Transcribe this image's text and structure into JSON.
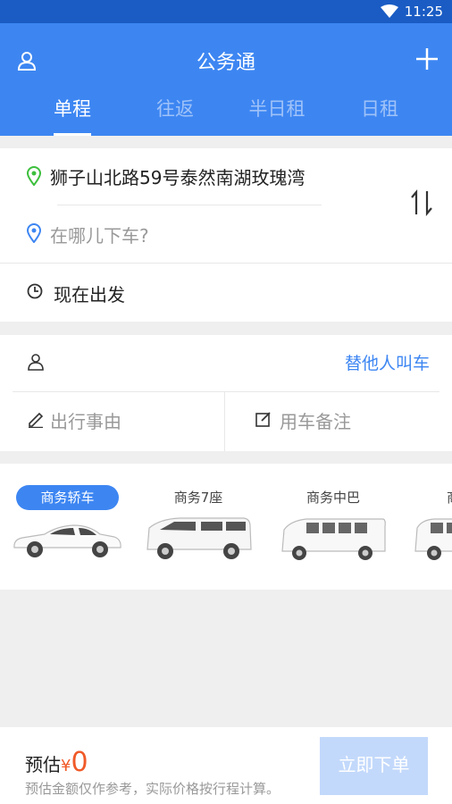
{
  "status_bar": {
    "time": "11:25"
  },
  "header": {
    "title": "公务通"
  },
  "tabs": [
    {
      "label": "单程",
      "active": true
    },
    {
      "label": "往返",
      "active": false
    },
    {
      "label": "半日租",
      "active": false
    },
    {
      "label": "日租",
      "active": false
    }
  ],
  "route": {
    "origin": "狮子山北路59号泰然南湖玫瑰湾",
    "destination_placeholder": "在哪儿下车?",
    "depart_time": "现在出发"
  },
  "passenger": {
    "call_for_other": "替他人叫车",
    "trip_reason_placeholder": "出行事由",
    "car_note_placeholder": "用车备注"
  },
  "car_types": [
    {
      "label": "商务轿车",
      "selected": true
    },
    {
      "label": "商务7座",
      "selected": false
    },
    {
      "label": "商务中巴",
      "selected": false
    },
    {
      "label": "商",
      "selected": false
    }
  ],
  "bottom_bar": {
    "estimate_label": "预估",
    "currency": "¥",
    "estimate_value": "0",
    "note": "预估金额仅作参考，实际价格按行程计算。",
    "order_button": "立即下单"
  },
  "colors": {
    "primary": "#3d86f2",
    "status_bar": "#1a5cc4",
    "accent_price": "#f05a28",
    "origin_pin": "#3cbf3c",
    "dest_pin": "#3d86f2"
  }
}
